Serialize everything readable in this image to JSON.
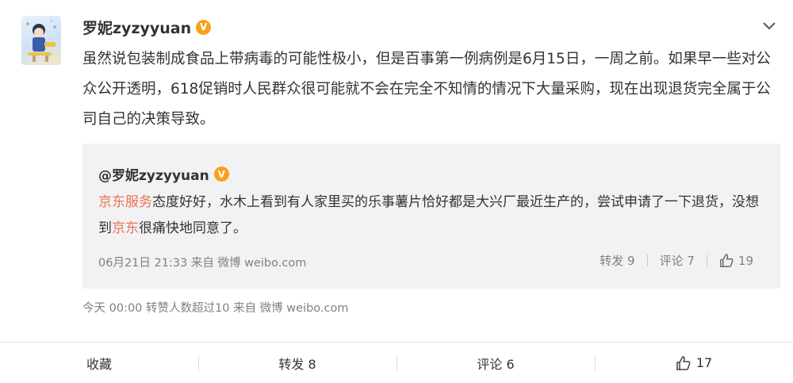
{
  "post": {
    "author": "罗妮zyzyyuan",
    "verified_badge": "V",
    "text": "虽然说包装制成食品上带病毒的可能性极小，但是百事第一例病例是6月15日，一周之前。如果早一些对公众公开透明，618促销时人民群众很可能就不会在完全不知情的情况下大量采购，现在出现退货完全属于公司自己的决策导致。",
    "meta": "今天 00:00 转赞人数超过10 来自 微博 weibo.com"
  },
  "repost": {
    "author": "@罗妮zyzyyuan",
    "verified_badge": "V",
    "text_link1": "京东服务",
    "text_part1": "态度好好，水木上看到有人家里买的乐事薯片恰好都是大兴厂最近生产的，尝试申请了一下退货，没想到",
    "text_link2": "京东",
    "text_part2": "很痛快地同意了。",
    "meta": "06月21日 21:33 来自 微博 weibo.com",
    "forward": "转发 9",
    "comment": "评论 7",
    "like": "19"
  },
  "actions": {
    "collect": "收藏",
    "forward": "转发 8",
    "comment": "评论 6",
    "like": "17"
  },
  "icons": {
    "expand": "chevron-down-icon",
    "like": "thumbs-up-icon",
    "verified": "verified-v-icon"
  },
  "colors": {
    "link": "#eb7350",
    "badge": "#f7a21b",
    "meta": "#808080",
    "repost_bg": "#f2f2f5"
  }
}
